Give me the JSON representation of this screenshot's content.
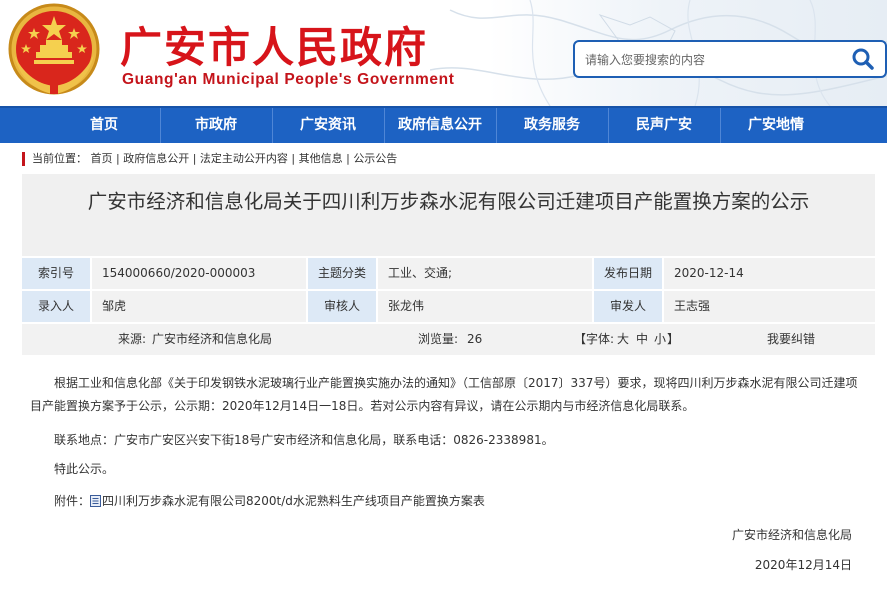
{
  "header": {
    "title": "广安市人民政府",
    "subtitle": "Guang'an Municipal People's Government",
    "emblem_icon": "national-emblem-icon",
    "colors": {
      "title": "#d7141a",
      "accent": "#1d62c3"
    }
  },
  "search": {
    "placeholder": "请输入您要搜索的内容",
    "button_icon": "search-icon"
  },
  "nav": {
    "items": [
      {
        "label": "首页"
      },
      {
        "label": "市政府"
      },
      {
        "label": "广安资讯"
      },
      {
        "label": "政府信息公开"
      },
      {
        "label": "政务服务"
      },
      {
        "label": "民声广安"
      },
      {
        "label": "广安地情"
      }
    ]
  },
  "breadcrumb": {
    "prefix": "当前位置：",
    "items": [
      "首页",
      "政府信息公开",
      "法定主动公开内容",
      "其他信息",
      "公示公告"
    ],
    "separator": " | "
  },
  "article": {
    "title": "广安市经济和信息化局关于四川利万步森水泥有限公司迁建项目产能置换方案的公示"
  },
  "meta": {
    "index_label": "索引号",
    "index_value": "154000660/2020-000003",
    "category_label": "主题分类",
    "category_value": "工业、交通;",
    "publish_date_label": "发布日期",
    "publish_date_value": "2020-12-14",
    "entered_by_label": "录入人",
    "entered_by_value": "邹虎",
    "reviewer_label": "审核人",
    "reviewer_value": "张龙伟",
    "issuer_label": "审发人",
    "issuer_value": "王志强",
    "source_label": "来源:",
    "source_value": "广安市经济和信息化局",
    "views_label": "浏览量:",
    "views_value": "26",
    "font_label": "【字体:",
    "font_large": "大",
    "font_medium": "中",
    "font_small": "小",
    "font_close": "】",
    "report_error": "我要纠错"
  },
  "content": {
    "p1": "根据工业和信息化部《关于印发钢铁水泥玻璃行业产能置换实施办法的通知》（工信部原〔2017〕337号）要求，现将四川利万步森水泥有限公司迁建项目产能置换方案予于公示，公示期：2020年12月14日一18日。若对公示内容有异议，请在公示期内与市经济信息化局联系。",
    "p2": "联系地点：广安市广安区兴安下街18号广安市经济和信息化局，联系电话：0826-2338981。",
    "p3": "特此公示。",
    "attachment_label": "附件：",
    "attachment_icon": "document-icon",
    "attachment_link": "四川利万步森水泥有限公司8200t/d水泥熟料生产线项目产能置换方案表",
    "signer": "广安市经济和信息化局",
    "date": "2020年12月14日"
  }
}
